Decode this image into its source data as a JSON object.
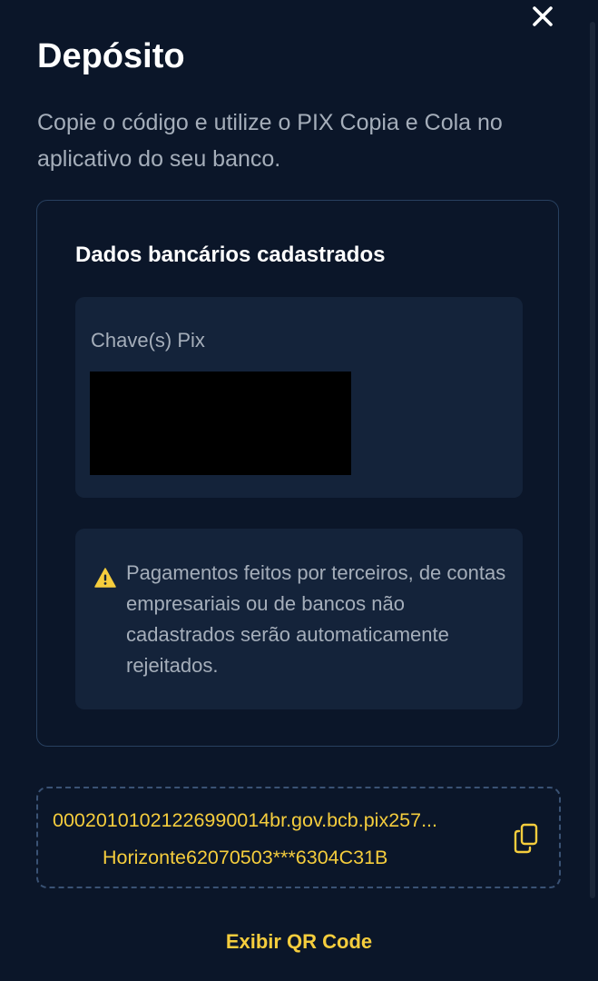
{
  "header": {
    "title": "Depósito",
    "subtitle": "Copie o código e utilize o PIX Copia e Cola no aplicativo do seu banco.",
    "close_icon": "close-icon"
  },
  "bank_card": {
    "title": "Dados bancários cadastrados",
    "pix_key": {
      "label": "Chave(s) Pix"
    },
    "warning": {
      "icon": "warning-icon",
      "text": "Pagamentos feitos por terceiros, de contas empresariais ou de bancos não cadastrados serão automaticamente rejeitados."
    }
  },
  "pix_code": {
    "line1": "00020101021226990014br.gov.bcb.pix257...",
    "line2": "Horizonte62070503***6304C31B",
    "copy_icon": "copy-icon"
  },
  "actions": {
    "show_qr_label": "Exibir QR Code"
  },
  "colors": {
    "background": "#0b1629",
    "panel": "#14233a",
    "accent": "#f5cd3d",
    "muted_text": "#a5aeba",
    "border": "#28405f"
  }
}
